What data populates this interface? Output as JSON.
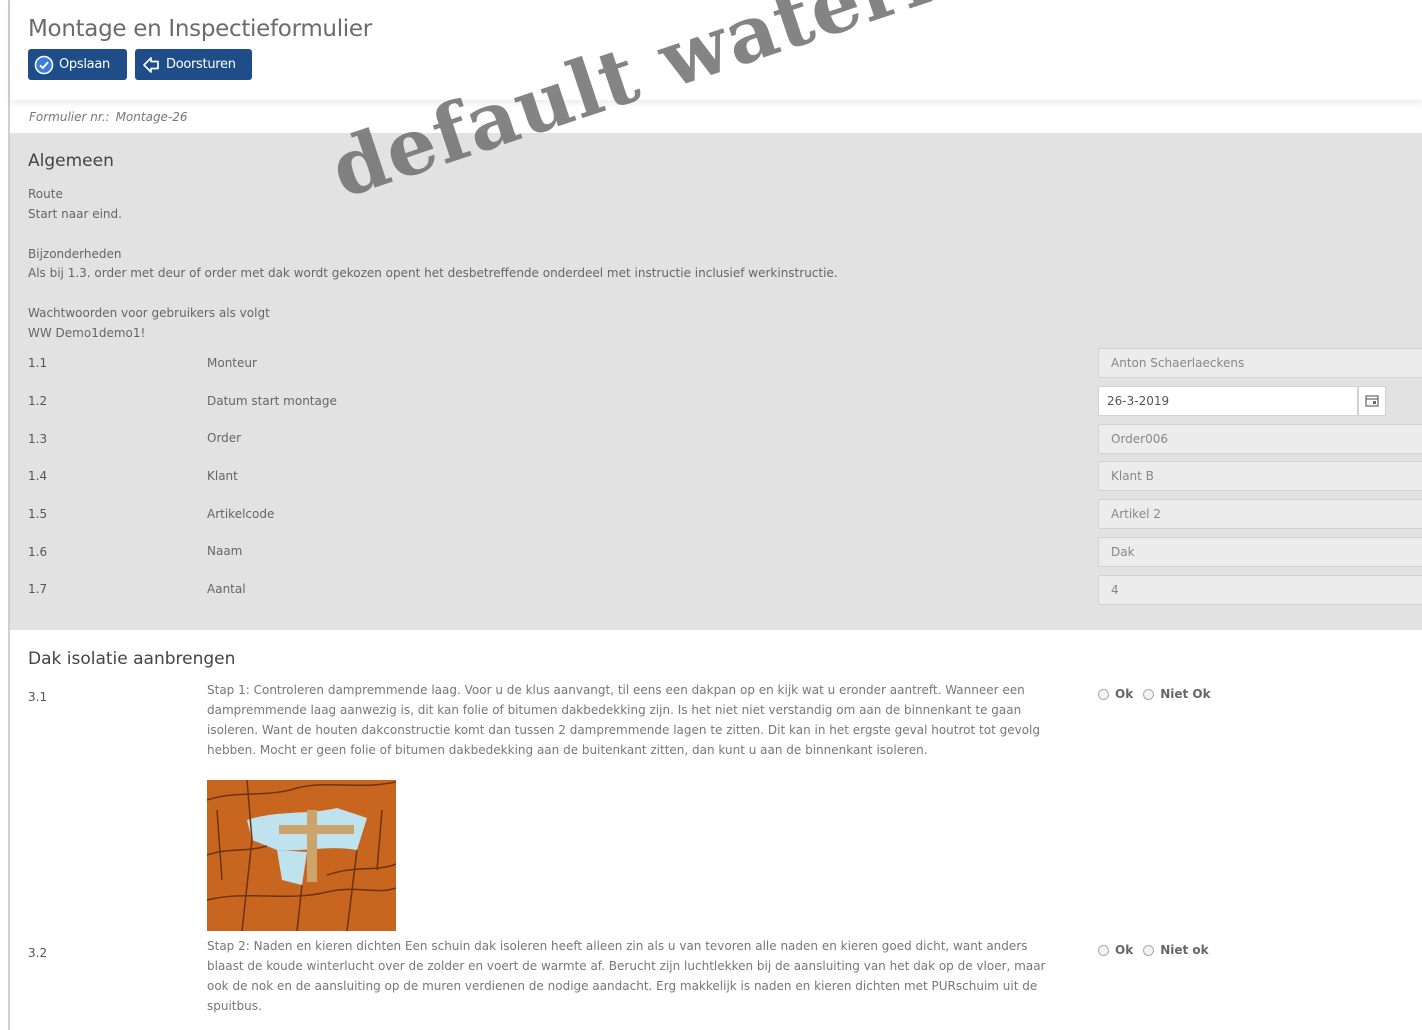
{
  "app_title": "Montage en Inspectieformulier",
  "toolbar": {
    "save_label": "Opslaan",
    "send_label": "Doorsturen"
  },
  "form_number": {
    "label": "Formulier nr.:",
    "value": "Montage-26"
  },
  "general": {
    "title": "Algemeen",
    "route_label": "Route",
    "route_text": "Start naar eind.",
    "details_label": "Bijzonderheden",
    "details_text": "Als bij 1.3. order met deur of order met dak wordt gekozen opent  het desbetreffende onderdeel met instructie inclusief werkinstructie.",
    "passwords_label": "Wachtwoorden voor gebruikers als volgt",
    "passwords_text": "WW Demo1demo1!",
    "rows": [
      {
        "num": "1.1",
        "label": "Monteur",
        "value": "Anton Schaerlaeckens"
      },
      {
        "num": "1.2",
        "label": "Datum start montage",
        "value": "26-3-2019"
      },
      {
        "num": "1.3",
        "label": "Order",
        "value": "Order006"
      },
      {
        "num": "1.4",
        "label": "Klant",
        "value": "Klant B"
      },
      {
        "num": "1.5",
        "label": "Artikelcode",
        "value": "Artikel 2"
      },
      {
        "num": "1.6",
        "label": "Naam",
        "value": "Dak"
      },
      {
        "num": "1.7",
        "label": "Aantal",
        "value": "4"
      }
    ]
  },
  "roof": {
    "title": "Dak isolatie aanbrengen",
    "steps": [
      {
        "num": "3.1",
        "text": "Stap 1: Controleren dampremmende laag. Voor u de klus aanvangt, til eens een dakpan op en kijk wat u eronder aantreft. Wanneer een dampremmende laag aanwezig is, dit kan folie of bitumen dakbedekking zijn. Is het niet niet verstandig om aan de binnenkant te gaan isoleren. Want de houten dakconstructie komt dan tussen 2 dampremmende lagen te zitten. Dit kan in het ergste geval houtrot tot gevolg hebben. Mocht er geen folie of bitumen dakbedekking aan de buitenkant zitten, dan kunt u aan de binnenkant isoleren.",
        "ok_label": "Ok",
        "not_ok_label": "Niet Ok"
      },
      {
        "num": "3.2",
        "text": "Stap 2: Naden en kieren dichten Een schuin dak isoleren heeft alleen zin als u van tevoren alle naden en kieren goed dicht, want anders blaast de koude winterlucht over de zolder en voert de warmte af. Berucht zijn luchtlekken bij de aansluiting van het dak op de vloer, maar ook de nok en de aansluiting op de muren verdienen de nodige aandacht. Erg makkelijk is naden en kieren dichten met PURschuim uit de spuitbus.",
        "ok_label": "Ok",
        "not_ok_label": "Niet ok"
      }
    ]
  },
  "watermark": "default watermark",
  "colors": {
    "button": "#1e4d8a",
    "section_bg": "#e2e2e2",
    "roof_tile": "#c8651e"
  },
  "icons": {
    "save": "check-circle-icon",
    "send": "forward-arrow-icon",
    "calendar": "calendar-icon"
  }
}
